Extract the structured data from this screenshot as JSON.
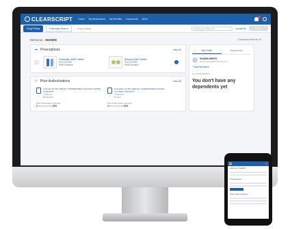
{
  "app": {
    "logo_text": "CLEARSCRIPT",
    "nav": [
      "Home",
      "My Medications",
      "My Benefits",
      "Documents",
      "More"
    ],
    "brand_color": "#1d5fa8"
  },
  "subbar": {
    "tabs": [
      "Drug Pricing",
      "Pharmacy Search",
      "Drug Lookup"
    ],
    "search_placeholder": "Find Drug or Pharmacy",
    "link": "Locate Rx",
    "button": "Search"
  },
  "welcome": {
    "prefix": "Welcome,",
    "name": "SHAWN",
    "download": "Download Member ID"
  },
  "prescriptions": {
    "title": "Prescriptions",
    "view_all": "View All",
    "items": [
      {
        "name": "Pravastatin 40MG Tablets",
        "detail1": "Rx# 0000000",
        "detail2": "Refill Available"
      },
      {
        "name": "Bisoprolol 5MG Tablets",
        "detail1": "Rx# 0000000",
        "detail2": "Refill Available"
      }
    ]
  },
  "authorizations": {
    "title": "Prior Authorizations",
    "view_all": "View All",
    "items": [
      {
        "name": "Lisinopril 10 MG TABLET (COMPRESSED) [SUGAR-COATED] (CAPLETS)",
        "status": "In Review",
        "badge": "Requested",
        "meta1_label": "Prior Authorization Number",
        "meta1_value": "2",
        "meta2_label": "Approved Units",
        "meta2_value": "N/A"
      },
      {
        "name": "Amlodipine 10 MG TABLET (COMPRESSED) [SUGAR-COATED] (CAPLETS)",
        "status": "In Review",
        "badge": "Denied",
        "meta1_label": "Prior Authorization Number",
        "meta1_value": "4",
        "meta2_label": "Approved Units",
        "meta2_value": "N/A"
      }
    ]
  },
  "family": {
    "tabs": [
      "My Profile",
      "My Account"
    ],
    "member_name": "SHAWN WHITE",
    "member_email": "shawn.white@clearscript.com",
    "add_link": "+ Add Dependent",
    "dependents_label": "MY DEPENDENTS",
    "no_dependents": "You don't have any dependents yet"
  },
  "phone": {
    "welcome": "Welcome, SHAWN",
    "section": "Prescriptions",
    "section2": "Prior Authorizations"
  }
}
